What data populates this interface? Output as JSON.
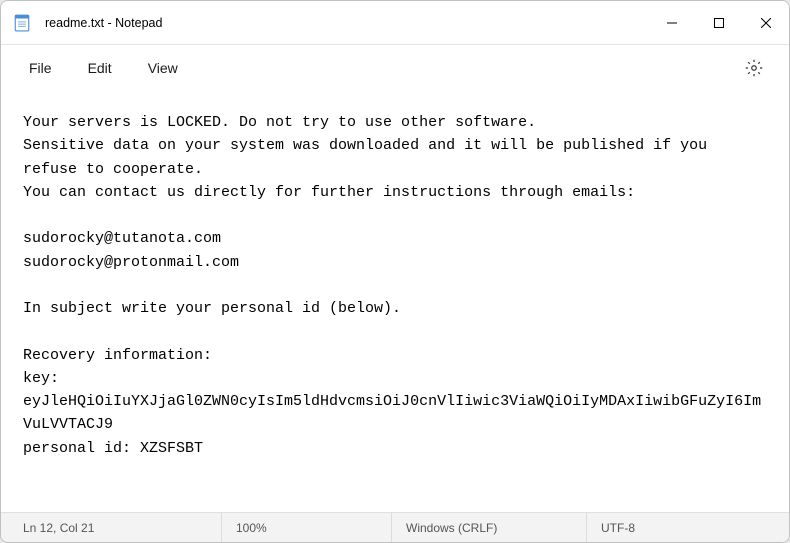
{
  "titlebar": {
    "title": "readme.txt - Notepad"
  },
  "menu": {
    "file": "File",
    "edit": "Edit",
    "view": "View"
  },
  "content": {
    "body": "Your servers is LOCKED. Do not try to use other software.\nSensitive data on your system was downloaded and it will be published if you refuse to cooperate.\nYou can contact us directly for further instructions through emails:\n\nsudorocky@tutanota.com\nsudorocky@protonmail.com\n\nIn subject write your personal id (below).\n\nRecovery information:\nkey:\neyJleHQiOiIuYXJjaGl0ZWN0cyIsIm5ldHdvcmsiOiJ0cnVlIiwic3ViaWQiOiIyMDAxIiwibGFuZyI6ImVuLVVTACJ9\npersonal id: XZSFSBT"
  },
  "statusbar": {
    "position": "Ln 12, Col 21",
    "zoom": "100%",
    "eol": "Windows (CRLF)",
    "encoding": "UTF-8"
  }
}
